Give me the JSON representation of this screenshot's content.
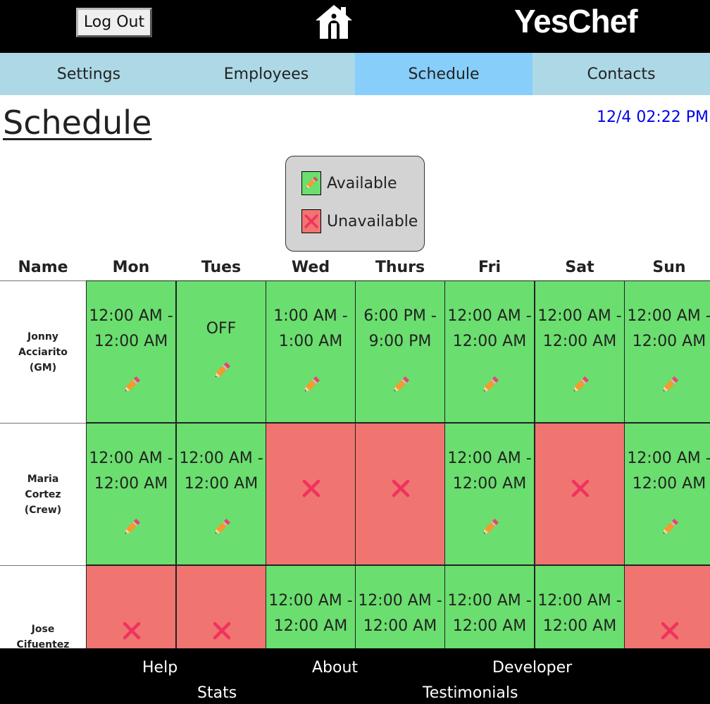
{
  "header": {
    "logout_label": "Log Out",
    "brand": "YesChef",
    "home_icon": "home-icon"
  },
  "nav": {
    "tabs": [
      {
        "label": "Settings",
        "active": false
      },
      {
        "label": "Employees",
        "active": false
      },
      {
        "label": "Schedule",
        "active": true
      },
      {
        "label": "Contacts",
        "active": false
      }
    ]
  },
  "page": {
    "title": "Schedule",
    "datetime": "12/4 02:22 PM"
  },
  "legend": {
    "available": "Available",
    "unavailable": "Unavailable"
  },
  "table": {
    "columns": [
      "Name",
      "Mon",
      "Tues",
      "Wed",
      "Thurs",
      "Fri",
      "Sat",
      "Sun"
    ],
    "rows": [
      {
        "name": "Jonny\nAcciarito\n(GM)",
        "cells": [
          {
            "status": "available",
            "text": "12:00 AM -\n12:00 AM"
          },
          {
            "status": "available",
            "text": "OFF"
          },
          {
            "status": "available",
            "text": "1:00 AM -\n1:00 AM"
          },
          {
            "status": "available",
            "text": "6:00 PM -\n9:00 PM"
          },
          {
            "status": "available",
            "text": "12:00 AM -\n12:00 AM"
          },
          {
            "status": "available",
            "text": "12:00 AM -\n12:00 AM"
          },
          {
            "status": "available",
            "text": "12:00 AM -\n12:00 AM"
          }
        ]
      },
      {
        "name": "Maria\nCortez\n(Crew)",
        "cells": [
          {
            "status": "available",
            "text": "12:00 AM -\n12:00 AM"
          },
          {
            "status": "available",
            "text": "12:00 AM -\n12:00 AM"
          },
          {
            "status": "unavailable",
            "text": ""
          },
          {
            "status": "unavailable",
            "text": ""
          },
          {
            "status": "available",
            "text": "12:00 AM -\n12:00 AM"
          },
          {
            "status": "unavailable",
            "text": ""
          },
          {
            "status": "available",
            "text": "12:00 AM -\n12:00 AM"
          }
        ]
      },
      {
        "name": "Jose\nCifuentez",
        "cells": [
          {
            "status": "unavailable",
            "text": ""
          },
          {
            "status": "unavailable",
            "text": ""
          },
          {
            "status": "available",
            "text": "12:00 AM -\n12:00 AM"
          },
          {
            "status": "available",
            "text": "12:00 AM -\n12:00 AM"
          },
          {
            "status": "available",
            "text": "12:00 AM -\n12:00 AM"
          },
          {
            "status": "available",
            "text": "12:00 AM -\n12:00 AM"
          },
          {
            "status": "unavailable",
            "text": ""
          }
        ]
      }
    ]
  },
  "footer": {
    "links": [
      "Help",
      "About",
      "Developer",
      "Stats",
      "Testimonials"
    ]
  },
  "colors": {
    "available": "#6ade6e",
    "unavailable": "#f07470",
    "nav": "#add8e6",
    "nav_active": "#87cefa",
    "datetime": "#0000ee"
  }
}
